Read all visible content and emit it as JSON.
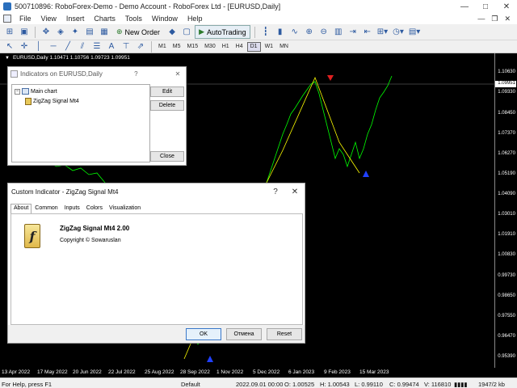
{
  "window": {
    "title": "500710896: RoboForex-Demo - Demo Account - RoboForex Ltd - [EURUSD,Daily]",
    "controls": [
      "—",
      "□",
      "✕"
    ]
  },
  "menu": {
    "items": [
      "File",
      "View",
      "Insert",
      "Charts",
      "Tools",
      "Window",
      "Help"
    ],
    "mdi_controls": [
      "—",
      "❐",
      "✕"
    ]
  },
  "toolbar": {
    "new_order_label": "New Order",
    "autotrading_label": "AutoTrading",
    "timeframes": [
      "M1",
      "M5",
      "M15",
      "M30",
      "H1",
      "H4",
      "D1",
      "W1",
      "MN"
    ],
    "active_timeframe": "D1"
  },
  "chart": {
    "info": "EURUSD,Daily  1.10471 1.10756 1.09723 1.09951",
    "current_price": "1.09951",
    "price_labels": [
      "1.10630",
      "1.09330",
      "1.08450",
      "1.07370",
      "1.06270",
      "1.05190",
      "1.04090",
      "1.03010",
      "1.01910",
      "1.00830",
      "0.99730",
      "0.98650",
      "0.97550",
      "0.96470",
      "0.95390"
    ],
    "time_labels": [
      "13 Apr 2022",
      "17 May 2022",
      "20 Jun 2022",
      "22 Jul 2022",
      "25 Aug 2022",
      "28 Sep 2022",
      "1 Nov 2022",
      "5 Dec 2022",
      "6 Jan 2023",
      "9 Feb 2023",
      "15 Mar 2023"
    ],
    "colors": {
      "background": "#000000",
      "price_line": "#00ff00",
      "zigzag": "#ffff00",
      "sell_arrow": "#e02020",
      "buy_arrow": "#2040ff"
    }
  },
  "indicators_window": {
    "title": "Indicators on EURUSD,Daily",
    "help": "?",
    "close": "✕",
    "tree_root": "Main chart",
    "tree_child": "ZigZag Signal Mt4",
    "edit_label": "Edit",
    "delete_label": "Delete",
    "close_label": "Close"
  },
  "custom_indicator": {
    "title": "Custom Indicator - ZigZag Signal Mt4",
    "help": "?",
    "close": "✕",
    "tabs": [
      "About",
      "Common",
      "Inputs",
      "Colors",
      "Visualization"
    ],
    "active_tab": "About",
    "name": "ZigZag Signal Mt4 2.00",
    "copyright": "Copyright © Sowaruslan",
    "icon_glyph": "f",
    "ok_label": "OK",
    "cancel_label": "Отмена",
    "reset_label": "Reset"
  },
  "status": {
    "help": "For Help, press F1",
    "profile": "Default",
    "datetime": "2022.09.01 00:00",
    "open": "O: 1.00525",
    "high": "H: 1.00543",
    "low": "L: 0.99110",
    "close": "C: 0.99474",
    "volume": "V: 116810",
    "traffic": "1947/2 kb"
  }
}
